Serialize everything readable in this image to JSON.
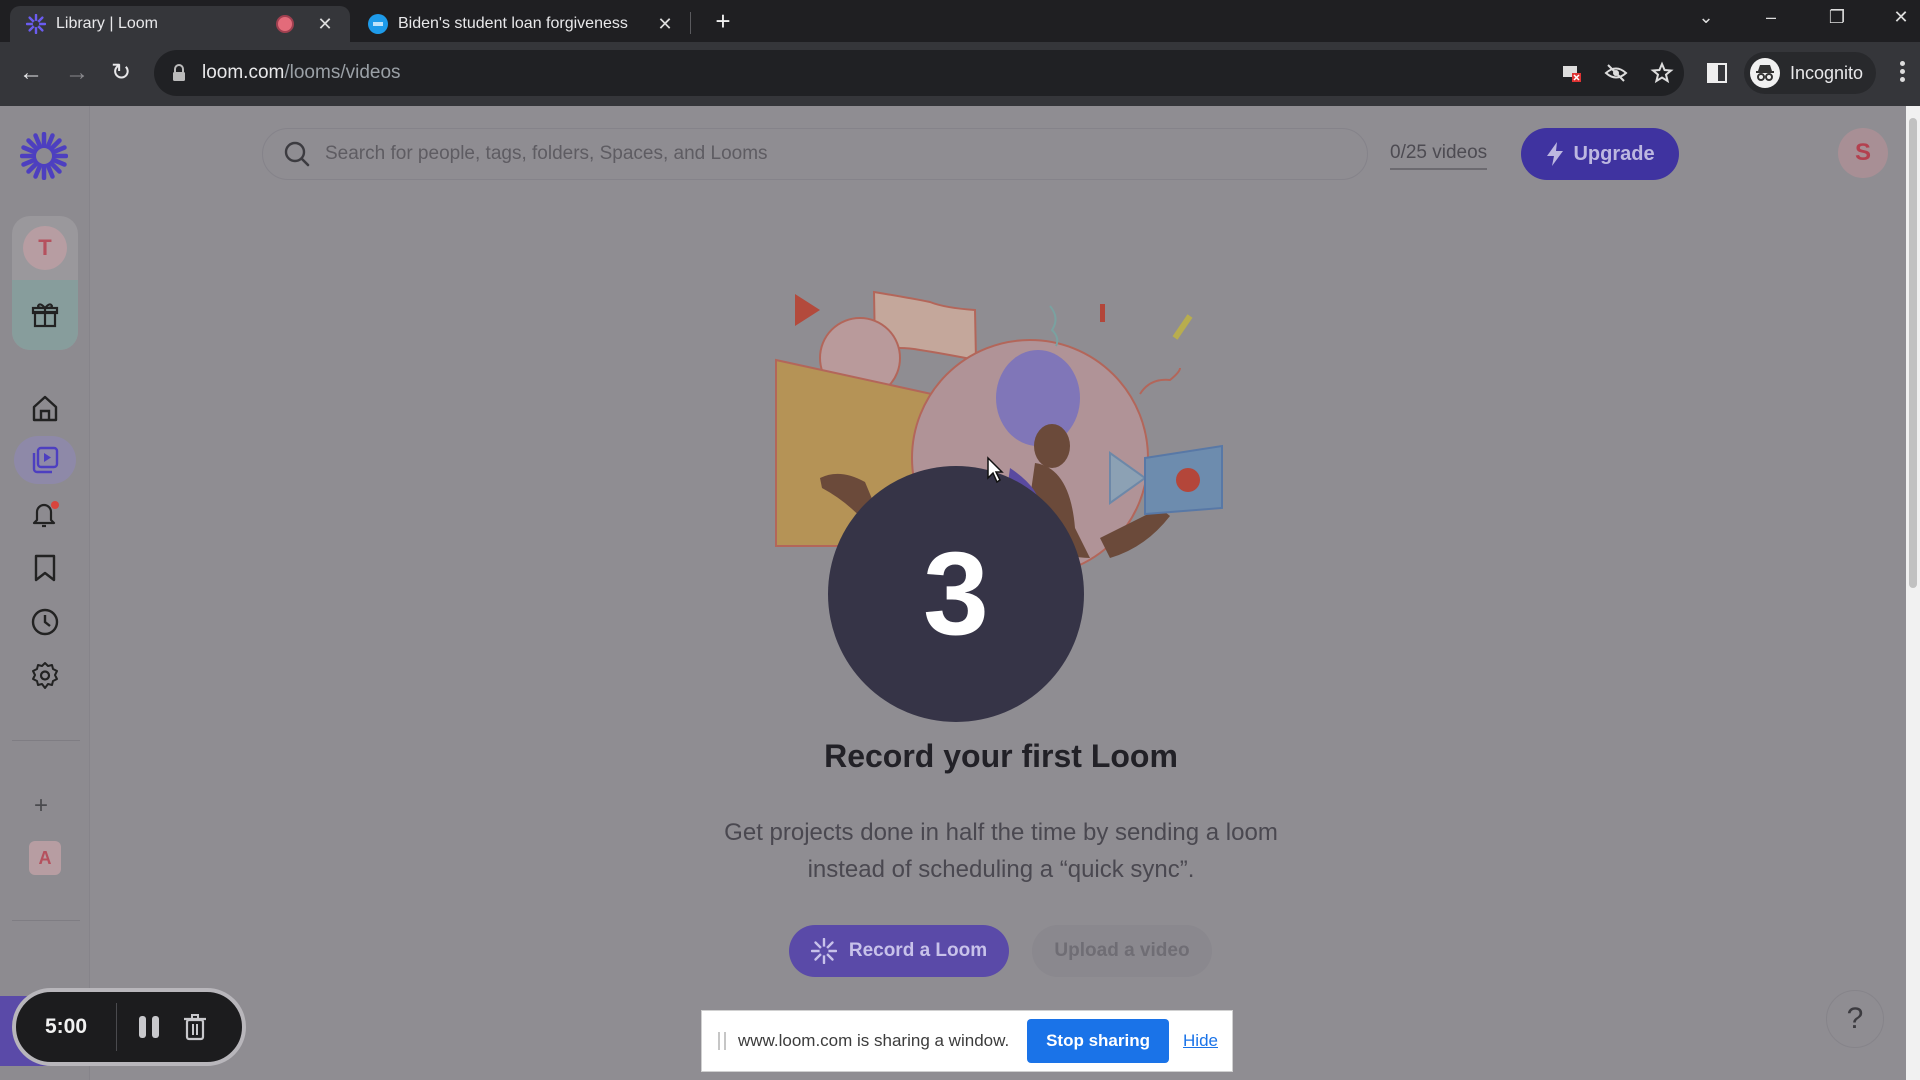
{
  "browser": {
    "tabs": [
      {
        "title": "Library | Loom",
        "active": true,
        "recording": true,
        "favicon": "loom-logo-icon"
      },
      {
        "title": "Biden's student loan forgiveness",
        "active": false,
        "favicon": "news-site-icon"
      }
    ],
    "new_tab_label": "+",
    "url_domain": "loom.com",
    "url_path": "/looms/videos",
    "profile_label": "Incognito",
    "window_controls": {
      "dropdown": "⌄",
      "minimize": "–",
      "restore": "❐",
      "close": "✕"
    }
  },
  "sidebar": {
    "workspace_avatar": "T",
    "items": [
      {
        "name": "home",
        "icon": "home-icon"
      },
      {
        "name": "library",
        "icon": "video-library-icon",
        "selected": true
      },
      {
        "name": "notifications",
        "icon": "bell-icon",
        "badge": true
      },
      {
        "name": "watch-later",
        "icon": "bookmark-icon"
      },
      {
        "name": "history",
        "icon": "clock-icon"
      },
      {
        "name": "settings",
        "icon": "gear-icon"
      }
    ],
    "add_label": "+",
    "space_avatar": "A"
  },
  "header": {
    "search_placeholder": "Search for people, tags, folders, Spaces, and Looms",
    "search_value": "",
    "quota": "0/25 videos",
    "upgrade_label": "Upgrade",
    "user_avatar": "S"
  },
  "main": {
    "countdown": "3",
    "headline": "Record your first Loom",
    "description_line1": "Get projects done in half the time by sending a loom",
    "description_line2": "instead of scheduling a “quick sync”.",
    "record_button": "Record a Loom",
    "upload_button": "Upload a video"
  },
  "recorder": {
    "time": "5:00"
  },
  "sharebar": {
    "message": "www.loom.com is sharing a window.",
    "stop_label": "Stop sharing",
    "hide_label": "Hide"
  },
  "help_label": "?",
  "colors": {
    "brand": "#565ADD",
    "upgrade": "#3f33a0",
    "stop_sharing": "#1a73e8"
  }
}
